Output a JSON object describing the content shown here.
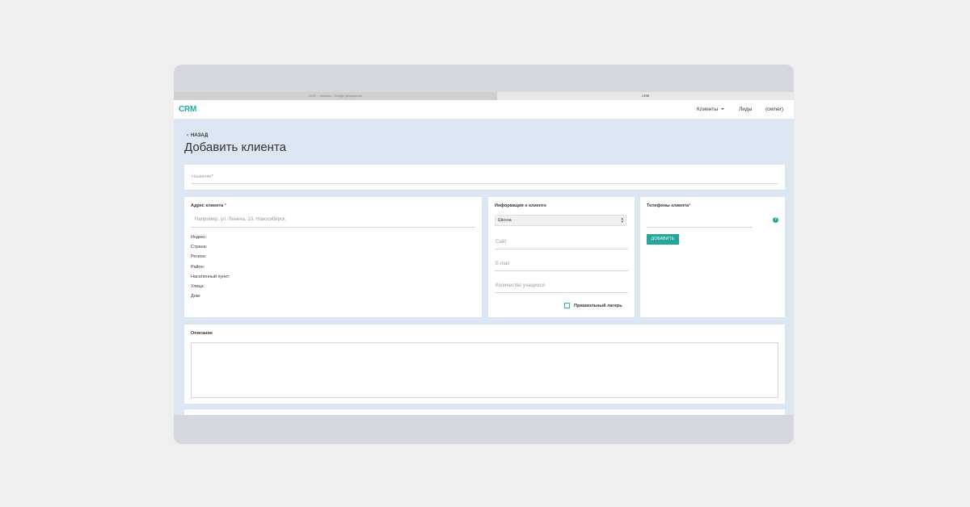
{
  "browser": {
    "tabs": [
      {
        "label": "ООО – письма – Google Документы"
      },
      {
        "label": "CRM"
      }
    ]
  },
  "navbar": {
    "logo": "CRM",
    "items": [
      {
        "label": "Клиенты"
      },
      {
        "label": "Лиды"
      },
      {
        "label": "(owner)"
      }
    ]
  },
  "page": {
    "back_label": "НАЗАД",
    "title": "Добавить клиента"
  },
  "name_field": {
    "label": "Название",
    "required_mark": "*"
  },
  "address": {
    "title": "Адрес клиента",
    "required_mark": "*",
    "placeholder": "Например, ул. Ленина, 10, Новосибирск",
    "fields": [
      {
        "label": "Индекс:"
      },
      {
        "label": "Страна:"
      },
      {
        "label": "Регион:"
      },
      {
        "label": "Район:"
      },
      {
        "label": "Населенный пункт:"
      },
      {
        "label": "Улица:"
      },
      {
        "label": "Дом:"
      }
    ]
  },
  "info": {
    "title": "Информация о клиенте",
    "type_select": {
      "value": "Школа"
    },
    "site_placeholder": "Сайт",
    "email_placeholder": "E-mail",
    "students_placeholder": "Количество учащихся",
    "camp_checkbox_label": "Пришкольный лагерь"
  },
  "phones": {
    "title": "Телефоны клиента",
    "required_mark": "*",
    "help_glyph": "?",
    "add_button": "ДОБАВИТЬ"
  },
  "description": {
    "title": "Описание"
  },
  "colors": {
    "accent": "#26a69a",
    "page_bg": "#dce7f3",
    "required": "#d9534f"
  }
}
